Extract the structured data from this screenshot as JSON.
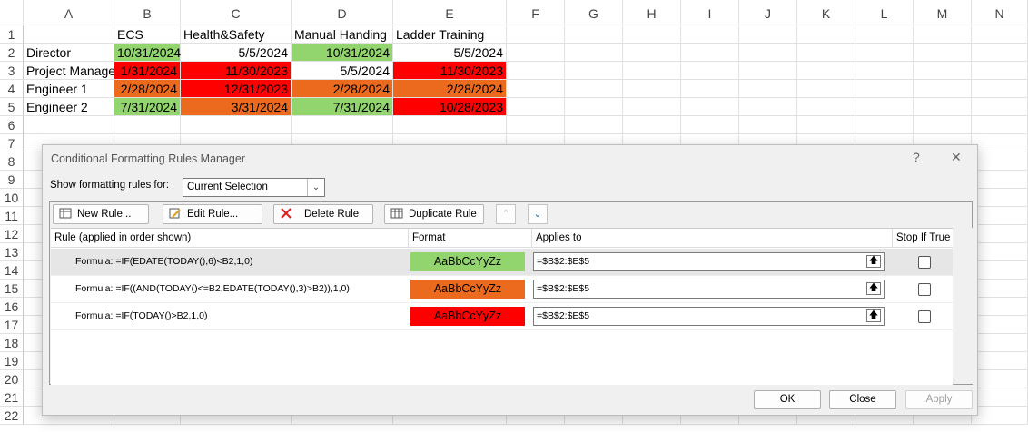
{
  "sheet": {
    "columns": [
      "A",
      "B",
      "C",
      "D",
      "E",
      "F",
      "G",
      "H",
      "I",
      "J",
      "K",
      "L",
      "M",
      "N"
    ],
    "rows": [
      "1",
      "2",
      "3",
      "4",
      "5",
      "6",
      "7",
      "8",
      "9",
      "10",
      "11",
      "12",
      "13",
      "14",
      "15",
      "16",
      "17",
      "18",
      "19",
      "20",
      "21",
      "22"
    ],
    "headers": [
      "ECS",
      "Health&Safety",
      "Manual Handing",
      "Ladder Training"
    ],
    "data": [
      {
        "name": "Director",
        "values": [
          "10/31/2024",
          "5/5/2024",
          "10/31/2024",
          "5/5/2024"
        ],
        "colors": [
          "green",
          "",
          "green",
          ""
        ]
      },
      {
        "name": "Project Manager",
        "values": [
          "1/31/2024",
          "11/30/2023",
          "5/5/2024",
          "11/30/2023"
        ],
        "colors": [
          "red",
          "red",
          "",
          "red"
        ]
      },
      {
        "name": "Engineer 1",
        "values": [
          "2/28/2024",
          "12/31/2023",
          "2/28/2024",
          "2/28/2024"
        ],
        "colors": [
          "orange",
          "red",
          "orange",
          "orange"
        ]
      },
      {
        "name": "Engineer 2",
        "values": [
          "7/31/2024",
          "3/31/2024",
          "7/31/2024",
          "10/28/2023"
        ],
        "colors": [
          "green",
          "orange",
          "green",
          "red"
        ]
      }
    ]
  },
  "dialog": {
    "title": "Conditional Formatting Rules Manager",
    "help": "?",
    "close": "✕",
    "show_label": "Show formatting rules for:",
    "show_value": "Current Selection",
    "buttons": {
      "new_rule": "New Rule...",
      "edit_rule": "Edit Rule...",
      "delete_rule": "Delete Rule",
      "duplicate_rule": "Duplicate Rule"
    },
    "columns": {
      "rule": "Rule (applied in order shown)",
      "format": "Format",
      "applies_to": "Applies to",
      "stop_if_true": "Stop If True"
    },
    "rules": [
      {
        "formula": "Formula: =IF(EDATE(TODAY(),6)<B2,1,0)",
        "preview": "AaBbCcYyZz",
        "color": "#92d46e",
        "applies": "=$B$2:$E$5",
        "stop": false
      },
      {
        "formula": "Formula: =IF((AND(TODAY()<=B2,EDATE(TODAY(),3)>B2)),1,0)",
        "preview": "AaBbCcYyZz",
        "color": "#ec6a1e",
        "applies": "=$B$2:$E$5",
        "stop": false
      },
      {
        "formula": "Formula: =IF(TODAY()>B2,1,0)",
        "preview": "AaBbCcYyZz",
        "color": "#ff0000",
        "applies": "=$B$2:$E$5",
        "stop": false
      }
    ],
    "ok": "OK",
    "close_btn": "Close",
    "apply": "Apply"
  }
}
